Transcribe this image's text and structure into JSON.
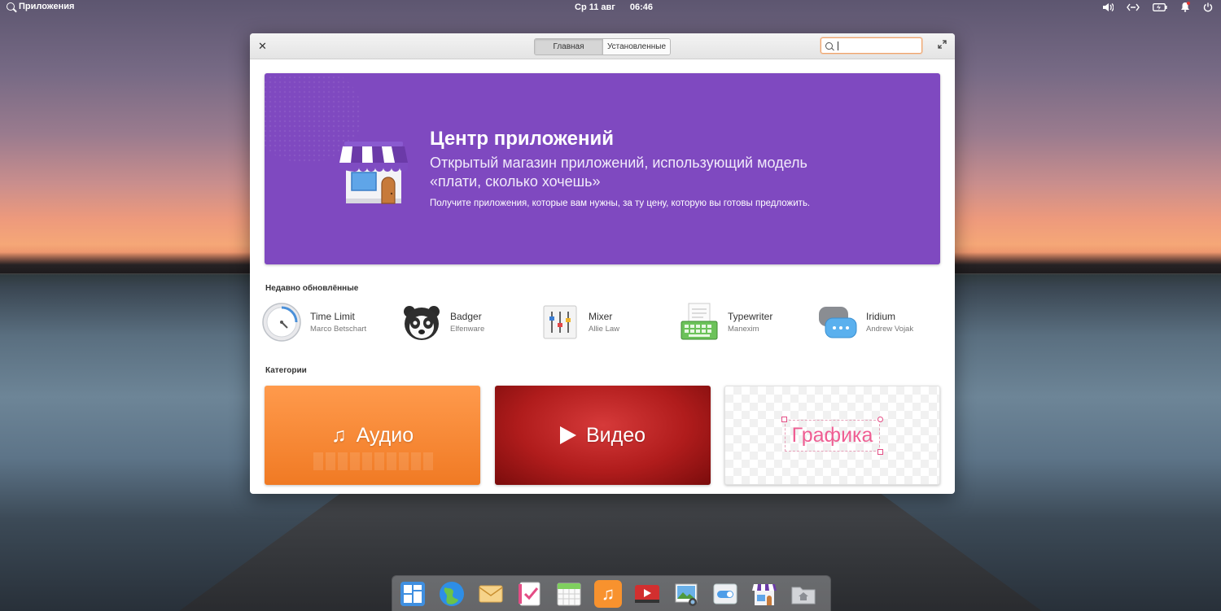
{
  "topbar": {
    "apps_label": "Приложения",
    "date": "Ср 11 авг",
    "time": "06:46",
    "indicators": [
      "volume-icon",
      "network-icon",
      "battery-icon",
      "notifications-icon",
      "power-icon"
    ]
  },
  "window": {
    "tabs": [
      {
        "label": "Главная",
        "active": true
      },
      {
        "label": "Установленные",
        "active": false
      }
    ],
    "search": {
      "value": "",
      "placeholder": ""
    }
  },
  "banner": {
    "title": "Центр приложений",
    "subtitle": "Открытый магазин приложений, использующий модель «плати, сколько хочешь»",
    "description": "Получите приложения, которые вам нужны, за ту цену, которую вы готовы предложить.",
    "color": "#7f49c0"
  },
  "recent": {
    "title": "Недавно обновлённые",
    "apps": [
      {
        "name": "Time Limit",
        "author": "Marco Betschart",
        "icon": "timer-icon"
      },
      {
        "name": "Badger",
        "author": "Elfenware",
        "icon": "badger-icon"
      },
      {
        "name": "Mixer",
        "author": "Allie Law",
        "icon": "mixer-icon"
      },
      {
        "name": "Typewriter",
        "author": "Manexim",
        "icon": "typewriter-icon"
      },
      {
        "name": "Iridium",
        "author": "Andrew Vojak",
        "icon": "chat-bubbles-icon"
      }
    ]
  },
  "categories": {
    "title": "Категории",
    "items": [
      {
        "label": "Аудио",
        "icon": "music-note-icon",
        "color": "#f58232"
      },
      {
        "label": "Видео",
        "icon": "play-icon",
        "color": "#b51e1e"
      },
      {
        "label": "Графика",
        "icon": "",
        "color": "#ef5e93"
      }
    ]
  },
  "dock": {
    "items": [
      "multitasking-view-icon",
      "web-browser-icon",
      "mail-icon",
      "tasks-icon",
      "calendar-icon",
      "music-icon",
      "videos-icon",
      "photos-icon",
      "settings-icon",
      "appcenter-icon",
      "files-icon"
    ]
  }
}
